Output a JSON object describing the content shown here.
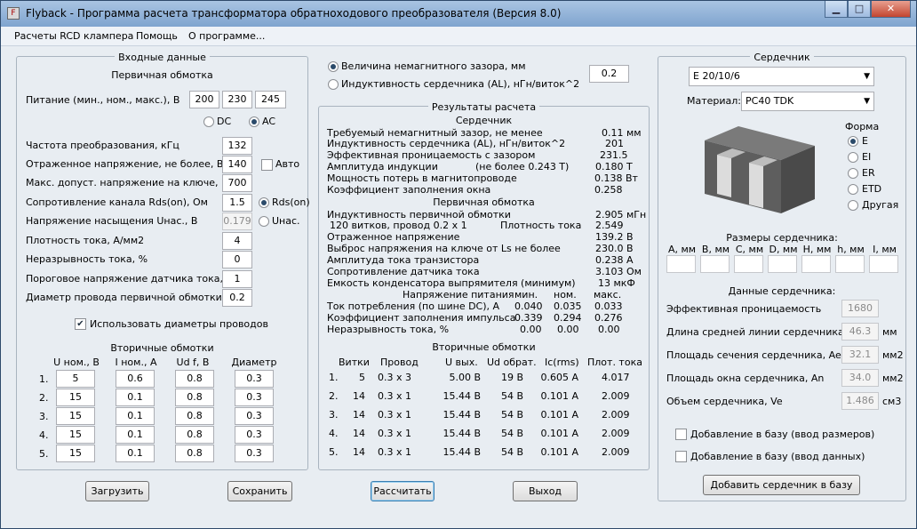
{
  "title": "Flyback - Программа расчета трансформатора обратноходового преобразователя (Версия 8.0)",
  "window_buttons": {
    "minimize": "▁",
    "maximize": "□",
    "close": "✕"
  },
  "menu": [
    "Расчеты RCD клампера",
    "Помощь",
    "О программе..."
  ],
  "input": {
    "heading": "Входные данные",
    "primary_heading": "Первичная обмотка",
    "supply_label": "Питание (мин., ном., макс.), В",
    "supply": [
      "200",
      "230",
      "245"
    ],
    "dc": "DC",
    "ac": "AC",
    "rows": [
      {
        "label": "Частота преобразования, кГц",
        "value": "132"
      },
      {
        "label": "Отраженное напряжение, не более, В",
        "value": "140"
      },
      {
        "label": "Макс. допуст. напряжение на ключе, В",
        "value": "700"
      },
      {
        "label": "Сопротивление канала Rds(on), Ом",
        "value": "1.5"
      },
      {
        "label": "Напряжение насыщения Uнас., В",
        "value": "0.179"
      },
      {
        "label": "Плотность тока, А/мм2",
        "value": "4"
      },
      {
        "label": "Неразрывность тока, %",
        "value": "0"
      },
      {
        "label": "Пороговое напряжение датчика тока, В",
        "value": "1"
      },
      {
        "label": "Диаметр провода первичной обмотки",
        "value": "0.2"
      }
    ],
    "auto": "Авто",
    "rds_on": "Rds(on)",
    "u_sat": "Uнас.",
    "use_diameters": "Использовать диаметры проводов",
    "secondary_heading": "Вторичные обмотки",
    "secondary_headers": [
      "U ном., В",
      "I ном., А",
      "Ud f, В",
      "Диаметр"
    ],
    "secondary_rows": [
      {
        "n": "1.",
        "values": [
          "5",
          "0.6",
          "0.8",
          "0.3"
        ]
      },
      {
        "n": "2.",
        "values": [
          "15",
          "0.1",
          "0.8",
          "0.3"
        ]
      },
      {
        "n": "3.",
        "values": [
          "15",
          "0.1",
          "0.8",
          "0.3"
        ]
      },
      {
        "n": "4.",
        "values": [
          "15",
          "0.1",
          "0.8",
          "0.3"
        ]
      },
      {
        "n": "5.",
        "values": [
          "15",
          "0.1",
          "0.8",
          "0.3"
        ]
      }
    ]
  },
  "gap_option": "Величина немагнитного зазора, мм",
  "al_option": "Индуктивность сердечника (AL), нГн/виток^2",
  "gap_value": "0.2",
  "results": {
    "heading": "Результаты расчета",
    "core_heading": "Сердечник",
    "core_rows": [
      {
        "label": "Требуемый немагнитный зазор, не менее",
        "value": "0.11 мм"
      },
      {
        "label": "Индуктивность сердечника (AL), нГн/виток^2",
        "value": "201"
      },
      {
        "label": "Эффективная проницаемость с зазором",
        "value": "231.5"
      },
      {
        "label": "Амплитуда индукции",
        "note": "(не более 0.243 Т)",
        "value": "0.180 Т"
      },
      {
        "label": "Мощность потерь в магнитопроводе",
        "value": "0.138 Вт"
      },
      {
        "label": "Коэффициент заполнения окна",
        "value": "0.258"
      }
    ],
    "primary_heading": "Первичная обмотка",
    "primary_rows": [
      {
        "label": "Индуктивность первичной обмотки",
        "value": "2.905 мГн"
      },
      {
        "label": "120 витков, провод 0.2 х 1",
        "note": "Плотность тока",
        "value": "2.549"
      },
      {
        "label": "Отраженное напряжение",
        "value": "139.2 В"
      },
      {
        "label": "Выброс напряжения на ключе от Ls не более",
        "value": "230.0 В"
      },
      {
        "label": "Амплитуда тока транзистора",
        "value": "0.238 А"
      },
      {
        "label": "Сопротивление датчика тока",
        "value": "3.103 Ом"
      },
      {
        "label": "Емкость конденсатора выпрямителя (минимум)",
        "value": "13 мкФ"
      }
    ],
    "supply_voltage_label": "Напряжение питания",
    "voltage_cols": [
      "мин.",
      "ном.",
      "макс."
    ],
    "voltage_rows": [
      {
        "label": "Ток потребления (по шине DC), А",
        "values": [
          "0.040",
          "0.035",
          "0.033"
        ]
      },
      {
        "label": "Коэффициент заполнения импульса",
        "values": [
          "0.339",
          "0.294",
          "0.276"
        ]
      },
      {
        "label": "Неразрывность тока, %",
        "values": [
          "0.00",
          "0.00",
          "0.00"
        ]
      }
    ],
    "secondary_heading": "Вторичные обмотки",
    "secondary_headers": [
      "Витки",
      "Провод",
      "U вых.",
      "Ud обрат.",
      "Ic(rms)",
      "Плот. тока"
    ],
    "secondary_rows": [
      [
        "1.",
        "5",
        "0.3 х 3",
        "5.00 В",
        "19 В",
        "0.605 А",
        "4.017"
      ],
      [
        "2.",
        "14",
        "0.3 х 1",
        "15.44 В",
        "54 В",
        "0.101 А",
        "2.009"
      ],
      [
        "3.",
        "14",
        "0.3 х 1",
        "15.44 В",
        "54 В",
        "0.101 А",
        "2.009"
      ],
      [
        "4.",
        "14",
        "0.3 х 1",
        "15.44 В",
        "54 В",
        "0.101 А",
        "2.009"
      ],
      [
        "5.",
        "14",
        "0.3 х 1",
        "15.44 В",
        "54 В",
        "0.101 А",
        "2.009"
      ]
    ]
  },
  "core": {
    "heading": "Сердечник",
    "core_selected": "E 20/10/6",
    "material_label": "Материал:",
    "material_selected": "PC40 TDK",
    "shape_label": "Форма",
    "shapes": [
      "E",
      "EI",
      "ER",
      "ETD",
      "Другая"
    ],
    "sizes_heading": "Размеры сердечника:",
    "size_cols": [
      "A, мм",
      "B, мм",
      "C, мм",
      "D, мм",
      "H, мм",
      "h, мм",
      "I, мм"
    ],
    "data_heading": "Данные сердечника:",
    "data_rows": [
      {
        "label": "Эффективная проницаемость",
        "value": "1680",
        "unit": ""
      },
      {
        "label": "Длина средней линии сердечника, le",
        "value": "46.3",
        "unit": "мм"
      },
      {
        "label": "Площадь сечения сердечника, Ae",
        "value": "32.1",
        "unit": "мм2"
      },
      {
        "label": "Площадь окна сердечника, An",
        "value": "34.0",
        "unit": "мм2"
      },
      {
        "label": "Объем сердечника, Ve",
        "value": "1.486",
        "unit": "см3"
      }
    ],
    "add_sizes": "Добавление в базу (ввод размеров)",
    "add_data": "Добавление в базу (ввод данных)",
    "add_core_button": "Добавить сердечник в базу"
  },
  "buttons": {
    "load": "Загрузить",
    "save": "Сохранить",
    "calculate": "Рассчитать",
    "exit": "Выход"
  }
}
